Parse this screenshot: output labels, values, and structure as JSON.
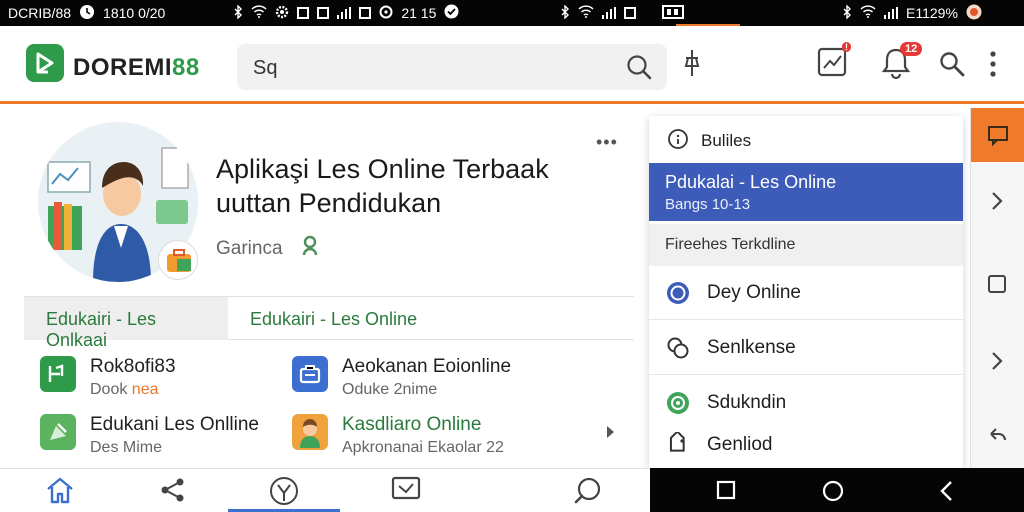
{
  "status": {
    "left_carrier": "DCRIB/88",
    "left_time": "1810 0/20",
    "mid_time": "21 15",
    "battery_text": "E1129%"
  },
  "app": {
    "logo_prefix": "DOREMI",
    "logo_suffix": "88",
    "search_text": "Sq",
    "notification_count": "12"
  },
  "course": {
    "title": "Aplikaşi Les Online Terbaak uuttan Pendidukan",
    "meta": "Garinca",
    "more": "•••"
  },
  "tabs": [
    {
      "label": "Edukairi - Les Onlkaai"
    },
    {
      "label": "Edukairi - Les Online"
    }
  ],
  "grid": [
    {
      "title": "Rok8ofi83",
      "sub_prefix": "Dook ",
      "sub_highlight": "nea",
      "icon_color": "#2e9b4b"
    },
    {
      "title": "Aeokanan Eoionline",
      "sub_prefix": "Oduke 2nime",
      "sub_highlight": "",
      "icon_color": "#3d5bb8"
    },
    {
      "title": "Edukani Les Onlline",
      "sub_prefix": "Des Mime",
      "sub_highlight": "",
      "icon_color": "#4caf50"
    },
    {
      "title": "Kasdliaro Online",
      "sub_prefix": "Apkronanai Ekaolar 22",
      "sub_highlight": "",
      "icon_color": "#f0a23c"
    }
  ],
  "menu": {
    "header": "Buliles",
    "selected_title": "Pdukalai - Les Online",
    "selected_sub": "Bangs 10-13",
    "section": "Fireehes Terkdline",
    "items": [
      {
        "label": "Dey Online",
        "icon": "radio-circle-icon"
      },
      {
        "label": "Senlkense",
        "icon": "link-circles-icon"
      },
      {
        "label": "Sdukndin",
        "icon": "green-circle-icon"
      },
      {
        "label": "Genliod",
        "icon": "tag-icon"
      }
    ]
  },
  "colors": {
    "brand_green": "#2e9b4b",
    "accent_orange": "#f07a2c",
    "selection_blue": "#3d5bb8"
  }
}
